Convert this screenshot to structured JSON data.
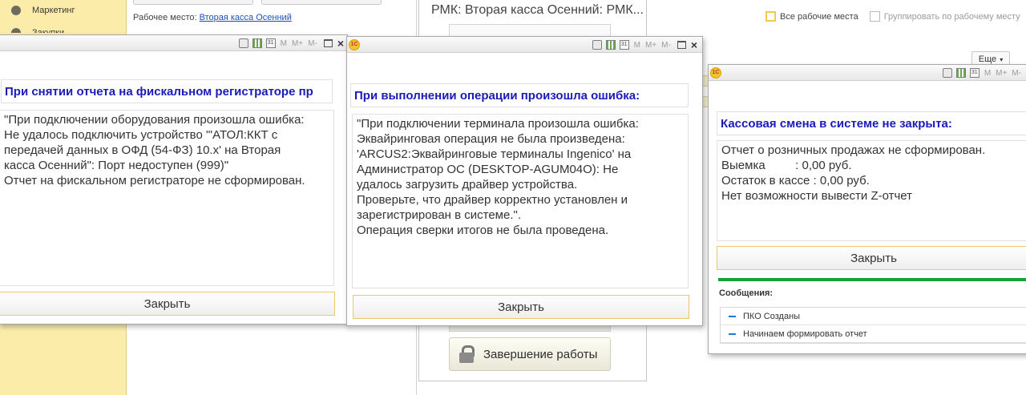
{
  "sidebar": {
    "items": [
      {
        "label": "Маркетинг",
        "icon": "pie-chart-icon"
      },
      {
        "label": "Закупки",
        "icon": "cart-icon"
      }
    ]
  },
  "workplace": {
    "label": "Рабочее место:",
    "value": "Вторая касса Осенний"
  },
  "rmk": {
    "title": "РМК: Вторая касса Осенний: РМК...",
    "finish_button": "Завершение работы"
  },
  "filters": {
    "all_workplaces": "Все рабочие места",
    "group_by_workplace": "Группировать по рабочему месту",
    "more_button": "Еще"
  },
  "toolbar": {
    "m": "M",
    "m_plus": "M+",
    "m_minus": "M-",
    "close": "×"
  },
  "dialog1": {
    "heading": "При снятии отчета на фискальном регистраторе пр",
    "text": "\"При подключении оборудования произошла ошибка:\nНе удалось подключить устройство \"'АТОЛ:ККТ с\nпередачей данных в ОФД (54-ФЗ) 10.x' на Вторая\nкасса Осенний\": Порт недоступен (999)\"\nОтчет на фискальном регистраторе не сформирован.",
    "close_button": "Закрыть"
  },
  "dialog2": {
    "heading": "При выполнении операции произошла ошибка:",
    "text": "\"При подключении терминала произошла ошибка:\nЭквайринговая операция не была произведена:\n'ARCUS2:Эквайринговые терминалы Ingenico' на\nАдминистратор ОС (DESKTOP-AGUM04O): Не\nудалось загрузить драйвер устройства.\nПроверьте, что драйвер корректно установлен и\nзарегистрирован в системе.\".\nОперация сверки итогов не была проведена.",
    "close_button": "Закрыть"
  },
  "dialog3": {
    "heading": "Кассовая смена в системе не закрыта:",
    "text": "Отчет о розничных продажах не сформирован.\nВыемка         : 0,00 руб.\nОстаток в кассе : 0,00 руб.\nНет возможности вывести Z-отчет",
    "close_button": "Закрыть",
    "messages_label": "Сообщения:",
    "messages": [
      "ПКО Созданы",
      "Начинаем формировать отчет"
    ]
  }
}
